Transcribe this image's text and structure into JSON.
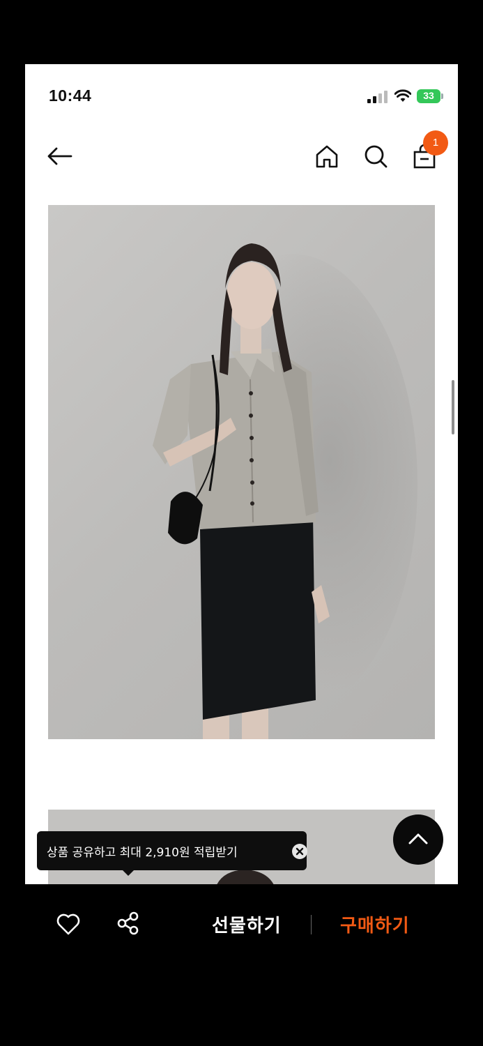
{
  "status_bar": {
    "time": "10:44",
    "battery_percent": "33"
  },
  "nav": {
    "cart_count": "1",
    "back_icon": "arrow-left-icon",
    "home_icon": "home-icon",
    "search_icon": "search-icon",
    "cart_icon": "shopping-bag-icon"
  },
  "toast": {
    "message": "상품 공유하고 최대 2,910원 적립받기",
    "close_icon": "close-circle-icon"
  },
  "bottom_bar": {
    "like_icon": "heart-outline-icon",
    "share_icon": "share-icon",
    "gift_label": "선물하기",
    "buy_label": "구매하기"
  },
  "colors": {
    "accent": "#f25a14",
    "battery": "#34c759",
    "background": "#ffffff",
    "bar_background": "#000000"
  }
}
